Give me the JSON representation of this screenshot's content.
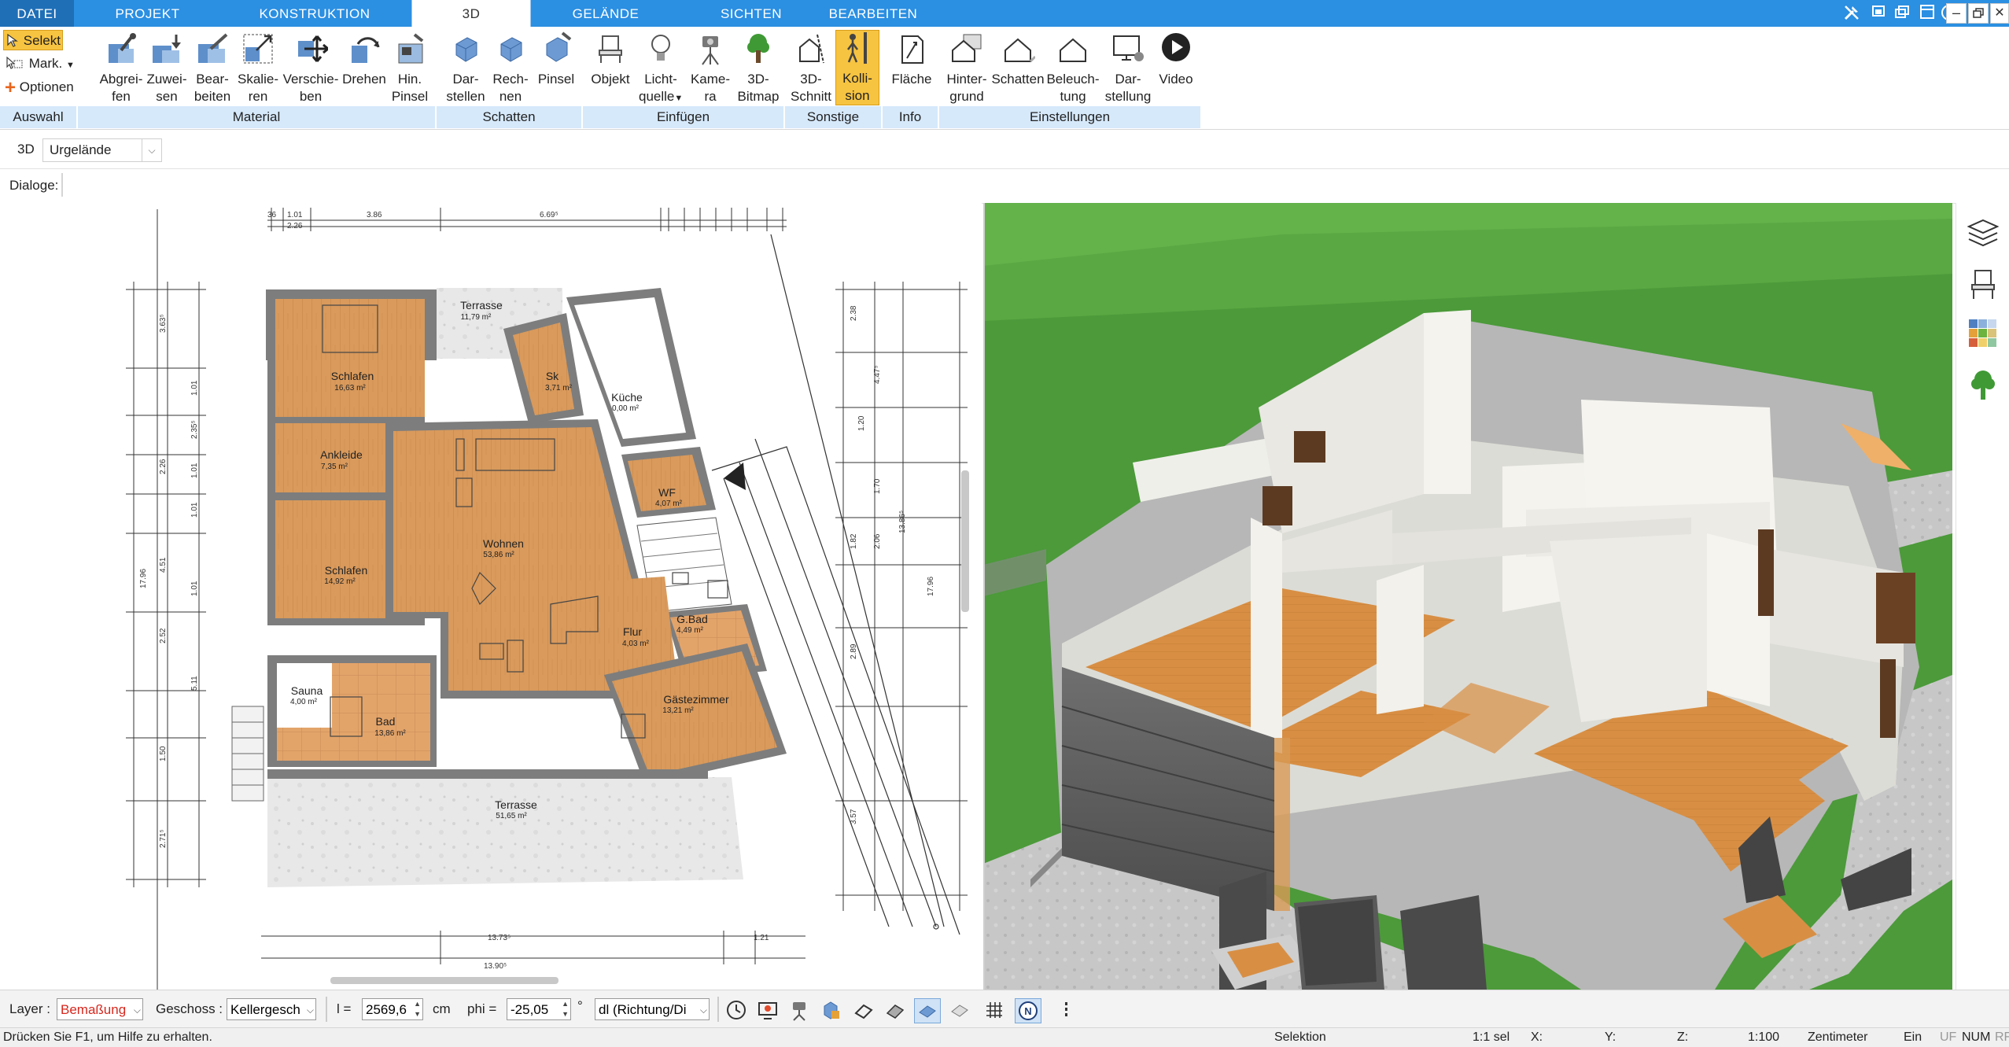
{
  "tabs": [
    {
      "label": "DATEI",
      "type": "file"
    },
    {
      "label": "PROJEKT"
    },
    {
      "label": "KONSTRUKTION"
    },
    {
      "label": "3D",
      "active": true
    },
    {
      "label": "GELÄNDE"
    },
    {
      "label": "SICHTEN"
    },
    {
      "label": "BEARBEITEN"
    }
  ],
  "selection_group": {
    "selekt": "Selekt",
    "mark": "Mark.",
    "optionen": "Optionen",
    "group_label": "Auswahl"
  },
  "ribbon_groups": [
    {
      "label": "Material",
      "buttons": [
        {
          "l1": "Abgrei-",
          "l2": "fen",
          "icon": "pipette-icon"
        },
        {
          "l1": "Zuwei-",
          "l2": "sen",
          "icon": "assign-material-icon"
        },
        {
          "l1": "Bear-",
          "l2": "beiten",
          "icon": "edit-material-icon"
        },
        {
          "l1": "Skalie-",
          "l2": "ren",
          "icon": "scale-icon"
        },
        {
          "l1": "Verschie-",
          "l2": "ben",
          "icon": "move-icon"
        },
        {
          "l1": "Drehen",
          "l2": "",
          "icon": "rotate-icon"
        },
        {
          "l1": "Hin.",
          "l2": "Pinsel",
          "icon": "background-brush-icon"
        }
      ]
    },
    {
      "label": "Schatten",
      "buttons": [
        {
          "l1": "Dar-",
          "l2": "stellen",
          "icon": "shadow-show-icon"
        },
        {
          "l1": "Rech-",
          "l2": "nen",
          "icon": "shadow-calc-icon"
        },
        {
          "l1": "Pinsel",
          "l2": "",
          "icon": "shadow-brush-icon"
        }
      ]
    },
    {
      "label": "Einfügen",
      "buttons": [
        {
          "l1": "Objekt",
          "l2": "",
          "icon": "chair-icon"
        },
        {
          "l1": "Licht-",
          "l2": "quelle",
          "icon": "light-bulb-icon"
        },
        {
          "l1": "Kame-",
          "l2": "ra",
          "icon": "camera-icon"
        },
        {
          "l1": "3D-",
          "l2": "Bitmap",
          "icon": "tree-icon"
        }
      ]
    },
    {
      "label": "Sonstige",
      "buttons": [
        {
          "l1": "3D-",
          "l2": "Schnitt",
          "icon": "section-cut-icon"
        },
        {
          "l1": "Kolli-",
          "l2": "sion",
          "icon": "collision-person-icon",
          "active": true
        }
      ]
    },
    {
      "label": "Info",
      "buttons": [
        {
          "l1": "Fläche",
          "l2": "",
          "icon": "area-info-icon"
        }
      ]
    },
    {
      "label": "Einstellungen",
      "buttons": [
        {
          "l1": "Hinter-",
          "l2": "grund",
          "icon": "background-house-icon"
        },
        {
          "l1": "Schatten",
          "l2": "",
          "icon": "shadow-house-icon"
        },
        {
          "l1": "Beleuch-",
          "l2": "tung",
          "icon": "lighting-house-icon"
        },
        {
          "l1": "Dar-",
          "l2": "stellung",
          "icon": "display-monitor-icon"
        },
        {
          "l1": "Video",
          "l2": "",
          "icon": "play-icon"
        }
      ]
    }
  ],
  "view_row": {
    "mode": "3D",
    "terrain": "Urgelände"
  },
  "dialog_row": {
    "label": "Dialoge:"
  },
  "floorplan": {
    "rooms": [
      {
        "name": "Terrasse",
        "area": "11,79 m²"
      },
      {
        "name": "Schlafen",
        "area": "16,63 m²"
      },
      {
        "name": "Sk",
        "area": "3,71 m²"
      },
      {
        "name": "Küche",
        "area": "0,00 m²"
      },
      {
        "name": "Ankleide",
        "area": "7,35 m²"
      },
      {
        "name": "WF",
        "area": "4,07 m²"
      },
      {
        "name": "Wohnen",
        "area": "53,86 m²"
      },
      {
        "name": "Schlafen",
        "area": "14,92 m²"
      },
      {
        "name": "G.Bad",
        "area": "4,49 m²"
      },
      {
        "name": "Flur",
        "area": "4,03 m²"
      },
      {
        "name": "Gästezimmer",
        "area": "13,21 m²"
      },
      {
        "name": "Sauna",
        "area": "4,00 m²"
      },
      {
        "name": "Bad",
        "area": "13,86 m²"
      },
      {
        "name": "Terrasse",
        "area": "51,65 m²"
      }
    ],
    "dims": {
      "top": [
        "36",
        "1.01",
        "2.26",
        "3.86",
        "6.69⁵"
      ],
      "left_total": "17.96",
      "left": [
        "3.63⁵",
        "1.01",
        "2.35⁵",
        "2.26",
        "1.01",
        "1.01",
        "4.51",
        "1.01",
        "2.52",
        "5.11",
        "1.50",
        "2.71⁵"
      ],
      "right": [
        "2.38",
        "4.47⁵",
        "1.20",
        "1.70",
        "2.06",
        "1.82",
        "2.89",
        "3.57",
        "13.86⁵",
        "17.96"
      ],
      "bottom": [
        "13.73⁵",
        "13.90⁵",
        "1.21"
      ]
    }
  },
  "bottom_toolbar": {
    "layer_label": "Layer :",
    "layer_value": "Bemaßung",
    "geschoss_label": "Geschoss :",
    "geschoss_value": "Kellergesch",
    "l_label": "l =",
    "l_value": "2569,6",
    "l_unit": "cm",
    "phi_label": "phi =",
    "phi_value": "-25,05",
    "phi_unit": "°",
    "dl_value": "dl (Richtung/Di"
  },
  "status": {
    "help": "Drücken Sie F1, um Hilfe zu erhalten.",
    "mode": "Selektion",
    "sel": "1:1 sel",
    "x": "X:",
    "y": "Y:",
    "z": "Z:",
    "scale": "1:100",
    "unit": "Zentimeter",
    "ein": "Ein",
    "uf": "UF",
    "num": "NUM",
    "rf": "RF"
  },
  "colors": {
    "tab_blue": "#2b8fe2",
    "file_tab": "#1f6fb7",
    "group_bar": "#d6e9fb",
    "active_button": "#f7c441",
    "wood_floor": "#d99a5c",
    "grass": "#4c9a3a",
    "sky_grass": "#63b24a",
    "layer_red": "#d6281e"
  }
}
